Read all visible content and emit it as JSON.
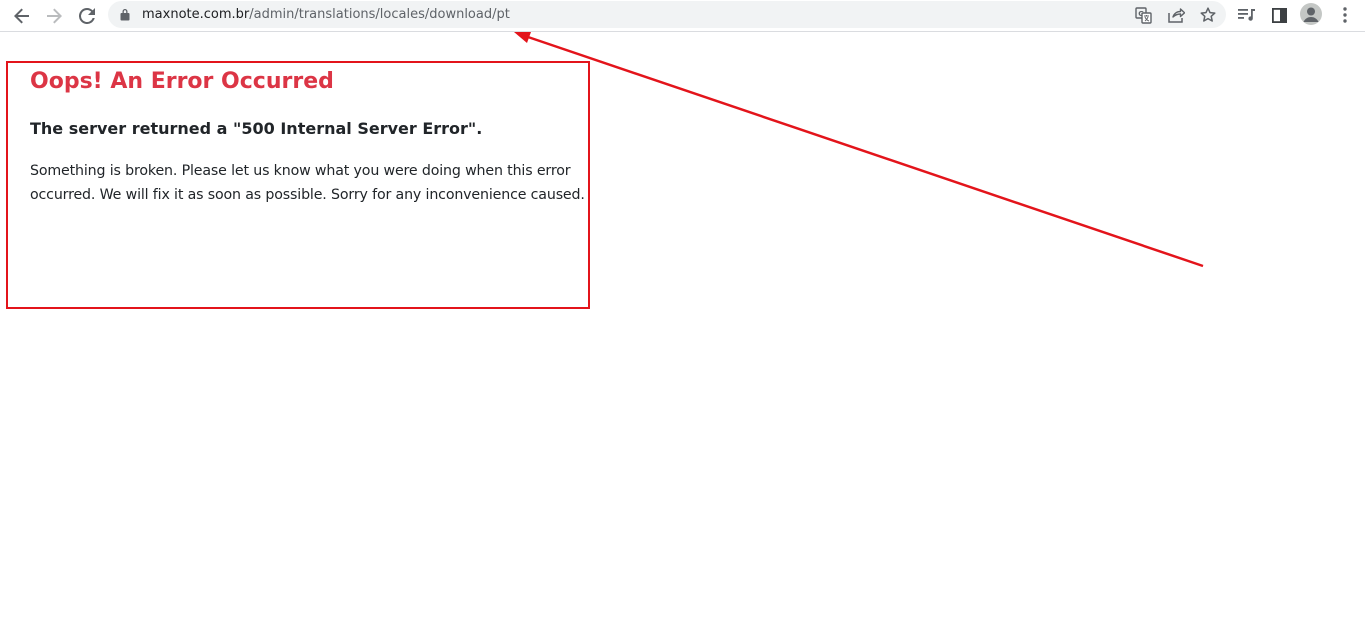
{
  "browser": {
    "url_host": "maxnote.com.br",
    "url_path": "/admin/translations/locales/download/pt",
    "icons": {
      "back": "arrow-left-icon",
      "forward": "arrow-right-icon",
      "reload": "reload-icon",
      "lock": "lock-icon",
      "translate": "translate-icon",
      "share": "share-icon",
      "bookmark": "star-icon",
      "media": "media-queue-icon",
      "side_panel": "side-panel-icon",
      "profile": "profile-avatar-icon",
      "menu": "kebab-menu-icon"
    }
  },
  "page": {
    "title": "Oops! An Error Occurred",
    "subtitle": "The server returned a \"500 Internal Server Error\".",
    "message": "Something is broken. Please let us know what you were doing when this error occurred. We will fix it as soon as possible. Sorry for any inconvenience caused."
  },
  "colors": {
    "error_title": "#dc3545",
    "text": "#212529",
    "annotation": "#e3141b",
    "omnibox": "#f1f3f4"
  }
}
